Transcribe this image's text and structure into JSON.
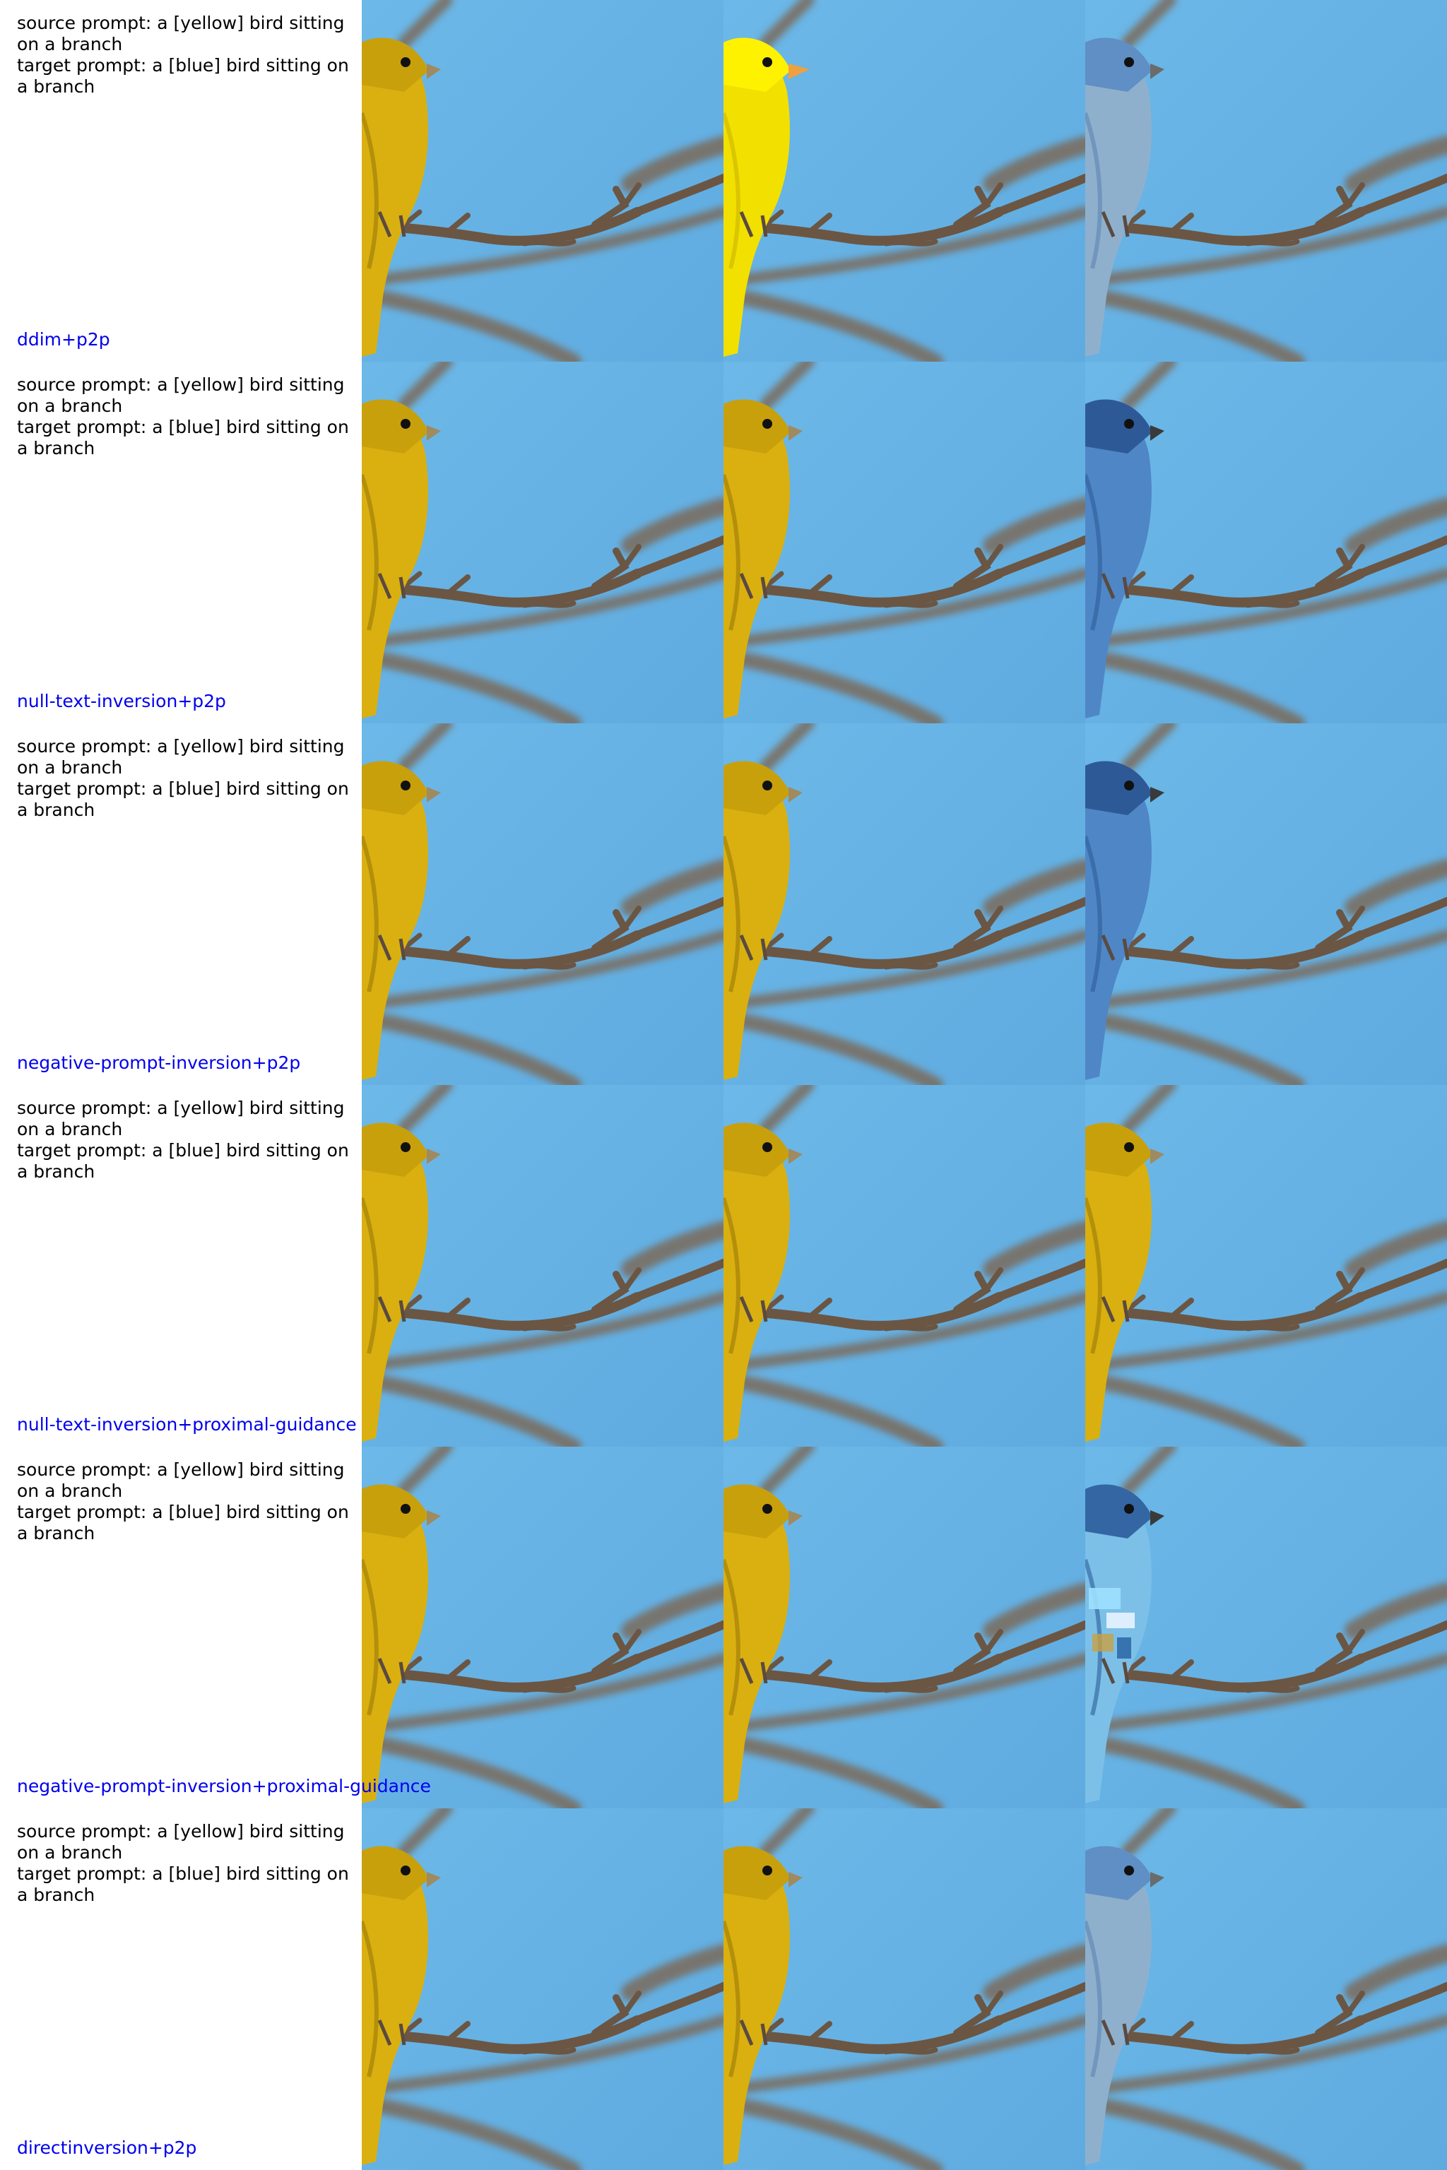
{
  "colors": {
    "method_label": "#0000ee",
    "sky": "#68b4e6",
    "branch": "#6b5644",
    "yellow_bird": "#d9b010",
    "bright_yellow_bird": "#f2e000",
    "blue_bird": "#4f86c6",
    "pale_blue_bird": "#8fb0cc"
  },
  "columns": [
    "source-image",
    "reconstruction",
    "edited-image"
  ],
  "rows": [
    {
      "source_prompt": "source prompt: a [yellow] bird sitting on a branch",
      "target_prompt": "target prompt: a [blue] bird sitting on a branch",
      "method": "ddim+p2p",
      "panels": [
        {
          "bird": "yellow",
          "icon": "yellow-bird-photo"
        },
        {
          "bird": "bright-yellow",
          "icon": "bright-yellow-bird-photo"
        },
        {
          "bird": "pale-blue",
          "icon": "pale-blue-bird-photo"
        }
      ]
    },
    {
      "source_prompt": "source prompt: a [yellow] bird sitting on a branch",
      "target_prompt": "target prompt: a [blue] bird sitting on a branch",
      "method": "null-text-inversion+p2p",
      "panels": [
        {
          "bird": "yellow",
          "icon": "yellow-bird-photo"
        },
        {
          "bird": "yellow",
          "icon": "yellow-bird-photo"
        },
        {
          "bird": "blue",
          "icon": "blue-bird-photo"
        }
      ]
    },
    {
      "source_prompt": "source prompt: a [yellow] bird sitting on a branch",
      "target_prompt": "target prompt: a [blue] bird sitting on a branch",
      "method": "negative-prompt-inversion+p2p",
      "panels": [
        {
          "bird": "yellow",
          "icon": "yellow-bird-photo"
        },
        {
          "bird": "yellow",
          "icon": "yellow-bird-photo"
        },
        {
          "bird": "blue",
          "icon": "blue-bird-photo"
        }
      ]
    },
    {
      "source_prompt": "source prompt: a [yellow] bird sitting on a branch",
      "target_prompt": "target prompt: a [blue] bird sitting on a branch",
      "method": "null-text-inversion+proximal-guidance",
      "panels": [
        {
          "bird": "yellow",
          "icon": "yellow-bird-photo"
        },
        {
          "bird": "yellow",
          "icon": "yellow-bird-photo"
        },
        {
          "bird": "yellow",
          "icon": "yellow-bird-photo"
        }
      ]
    },
    {
      "source_prompt": "source prompt: a [yellow] bird sitting on a branch",
      "target_prompt": "target prompt: a [blue] bird sitting on a branch",
      "method": "negative-prompt-inversion+proximal-guidance",
      "panels": [
        {
          "bird": "yellow",
          "icon": "yellow-bird-photo"
        },
        {
          "bird": "yellow",
          "icon": "yellow-bird-photo"
        },
        {
          "bird": "glitched-blue",
          "icon": "glitched-blue-bird-photo"
        }
      ]
    },
    {
      "source_prompt": "source prompt: a [yellow] bird sitting on a branch",
      "target_prompt": "target prompt: a [blue] bird sitting on a branch",
      "method": "directinversion+p2p",
      "panels": [
        {
          "bird": "yellow",
          "icon": "yellow-bird-photo"
        },
        {
          "bird": "yellow",
          "icon": "yellow-bird-photo"
        },
        {
          "bird": "pale-blue",
          "icon": "pale-blue-bird-photo"
        }
      ]
    }
  ]
}
